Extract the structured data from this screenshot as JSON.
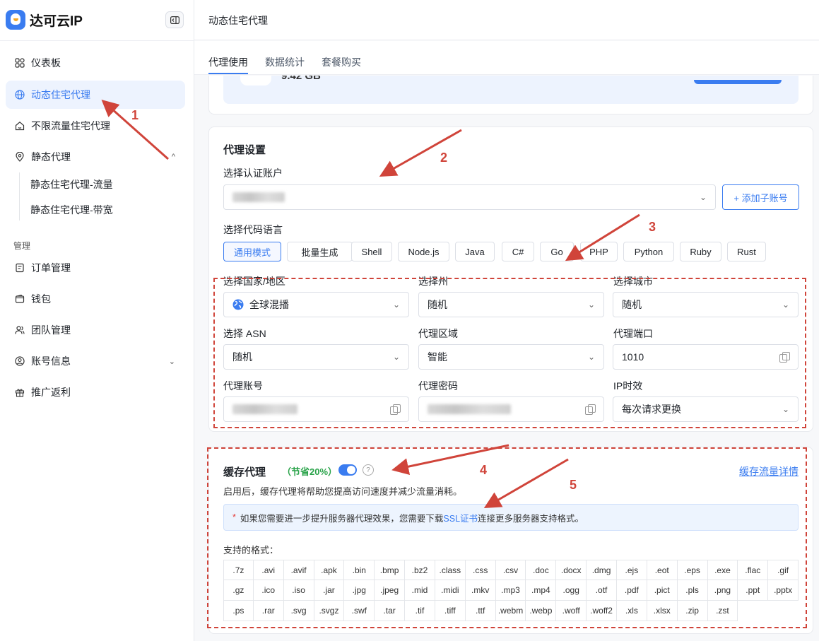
{
  "brand": {
    "name": "达可云IP"
  },
  "sidebar": {
    "items": [
      {
        "label": "仪表板",
        "icon": "grid-icon"
      },
      {
        "label": "动态住宅代理",
        "icon": "globe-icon"
      },
      {
        "label": "不限流量住宅代理",
        "icon": "home-icon"
      },
      {
        "label": "静态代理",
        "icon": "location-pin-icon"
      }
    ],
    "sub_items": [
      "静态住宅代理-流量",
      "静态住宅代理-带宽"
    ],
    "group_label": "管理",
    "manage_items": [
      {
        "label": "订单管理",
        "icon": "order-icon"
      },
      {
        "label": "钱包",
        "icon": "wallet-icon"
      },
      {
        "label": "团队管理",
        "icon": "team-icon"
      },
      {
        "label": "账号信息",
        "icon": "user-circle-icon"
      },
      {
        "label": "推广返利",
        "icon": "gift-icon"
      }
    ]
  },
  "header": {
    "title": "动态住宅代理"
  },
  "tabs": [
    "代理使用",
    "数据统计",
    "套餐购买"
  ],
  "balance": {
    "value": "9.42 GB"
  },
  "proxy_settings": {
    "title": "代理设置",
    "account_label": "选择认证账户",
    "add_sub_account": "+ 添加子账号",
    "code_lang_label": "选择代码语言",
    "languages": [
      "通用模式",
      "批量生成",
      "Shell",
      "Node.js",
      "Java",
      "C#",
      "Go",
      "PHP",
      "Python",
      "Ruby",
      "Rust"
    ],
    "fields": {
      "country_label": "选择国家/地区",
      "country_value": "全球混播",
      "state_label": "选择州",
      "state_value": "随机",
      "city_label": "选择城市",
      "city_value": "随机",
      "asn_label": "选择 ASN",
      "asn_value": "随机",
      "region_label": "代理区域",
      "region_value": "智能",
      "port_label": "代理端口",
      "port_value": "1010",
      "user_label": "代理账号",
      "pass_label": "代理密码",
      "ttl_label": "IP时效",
      "ttl_value": "每次请求更换"
    }
  },
  "cache": {
    "title": "缓存代理",
    "save_tag": "（节省20%）",
    "detail_link": "缓存流量详情",
    "desc": "启用后，缓存代理将帮助您提高访问速度并减少流量消耗。",
    "notice_star": "*",
    "notice_pre": "如果您需要进一步提升服务器代理效果，您需要下载 ",
    "notice_link": "SSL证书",
    "notice_post": "连接更多服务器支持格式。",
    "formats_label": "支持的格式：",
    "formats": [
      ".7z",
      ".avi",
      ".avif",
      ".apk",
      ".bin",
      ".bmp",
      ".bz2",
      ".class",
      ".css",
      ".csv",
      ".doc",
      ".docx",
      ".dmg",
      ".ejs",
      ".eot",
      ".eps",
      ".exe",
      ".flac",
      ".gif",
      ".gz",
      ".ico",
      ".iso",
      ".jar",
      ".jpg",
      ".jpeg",
      ".mid",
      ".midi",
      ".mkv",
      ".mp3",
      ".mp4",
      ".ogg",
      ".otf",
      ".pdf",
      ".pict",
      ".pls",
      ".png",
      ".ppt",
      ".pptx",
      ".ps",
      ".rar",
      ".svg",
      ".svgz",
      ".swf",
      ".tar",
      ".tif",
      ".tiff",
      ".ttf",
      ".webm",
      ".webp",
      ".woff",
      ".woff2",
      ".xls",
      ".xlsx",
      ".zip",
      ".zst"
    ]
  },
  "annotations": {
    "n1": "1",
    "n2": "2",
    "n3": "3",
    "n4": "4",
    "n5": "5",
    "color": "#d0443a"
  },
  "colors": {
    "accent": "#3a7cf0",
    "active_bg": "#edf3fe",
    "success": "#2aa34a"
  }
}
